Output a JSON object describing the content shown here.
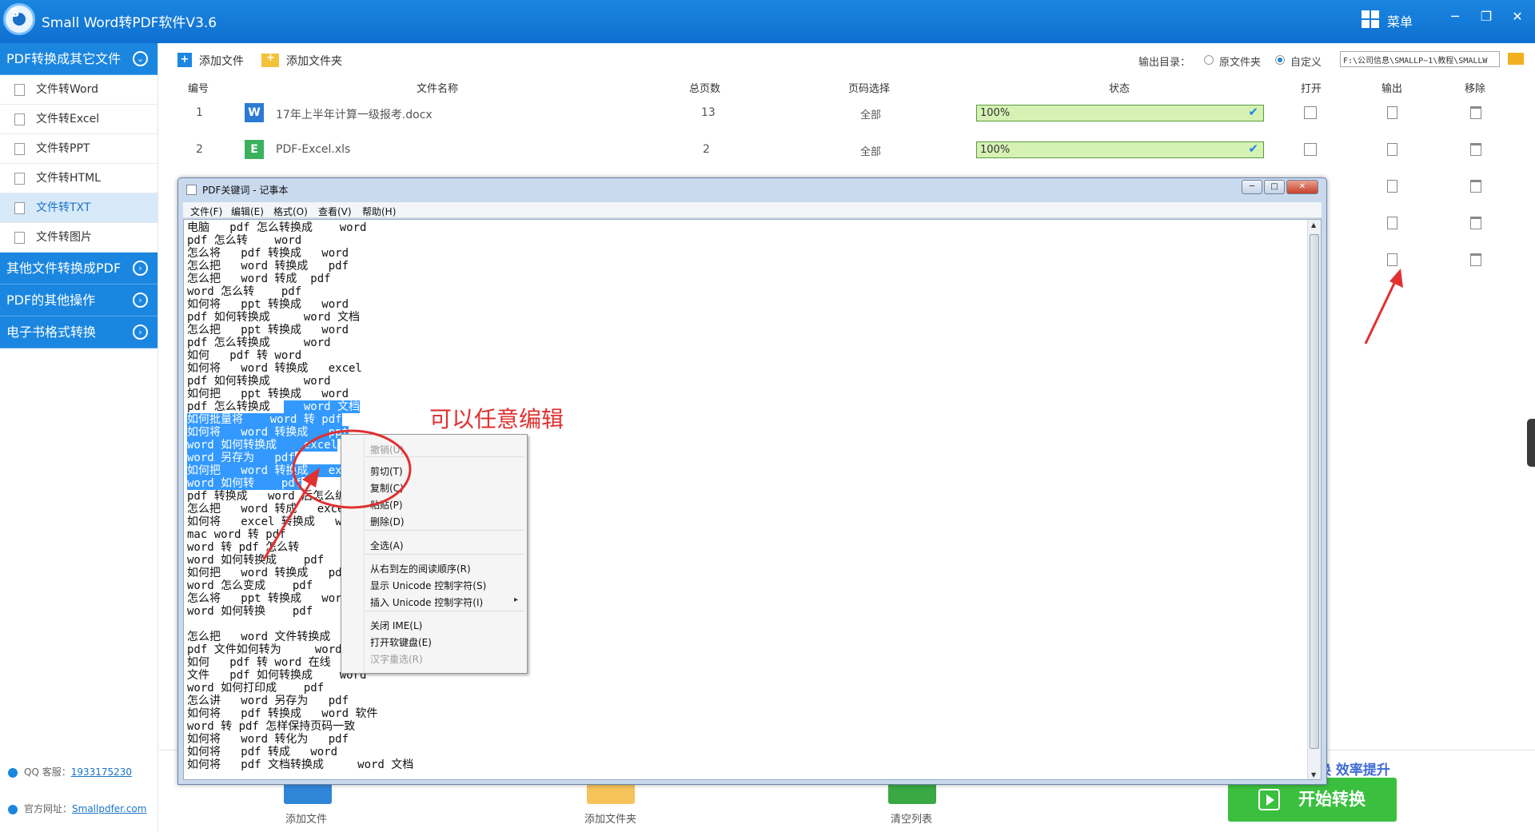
{
  "app": {
    "title": "Small  Word转PDF软件V3.6",
    "menu_label": "菜单",
    "window_minimize": "─",
    "window_restore": "❐",
    "window_close": "✕"
  },
  "sidebar": {
    "sections": [
      {
        "label": "PDF转换成其它文件",
        "expanded": true
      },
      {
        "label": "其他文件转换成PDF"
      },
      {
        "label": "PDF的其他操作"
      },
      {
        "label": "电子书格式转换"
      }
    ],
    "items": [
      {
        "label": "文件转Word",
        "icon": "W"
      },
      {
        "label": "文件转Excel",
        "icon": "E"
      },
      {
        "label": "文件转PPT",
        "icon": "P"
      },
      {
        "label": "文件转HTML",
        "icon": "H"
      },
      {
        "label": "文件转TXT",
        "icon": "T",
        "active": true
      },
      {
        "label": "文件转图片",
        "icon": "I"
      }
    ],
    "qq_label": "QQ 客服：",
    "qq_number": "1933175230",
    "site_label": "官方网址：",
    "site_url": "Smallpdfer.com"
  },
  "toolbar": {
    "add_file": "添加文件",
    "add_folder": "添加文件夹",
    "output_dir_label": "输出目录：",
    "radio_original": "原文件夹",
    "radio_custom": "自定义",
    "output_path": "F:\\公司信息\\SMALLP~1\\教程\\SMALLW"
  },
  "table": {
    "headers": {
      "num": "编号",
      "name": "文件名称",
      "pages": "总页数",
      "range": "页码选择",
      "status": "状态",
      "open": "打开",
      "output": "输出",
      "remove": "移除"
    },
    "rows": [
      {
        "num": "1",
        "name": "17年上半年计算一级报考.docx",
        "pages": "13",
        "range": "全部",
        "progress": "100%",
        "type": "W",
        "color": "#2b7bd3"
      },
      {
        "num": "2",
        "name": "PDF-Excel.xls",
        "pages": "2",
        "range": "全部",
        "progress": "100%",
        "type": "E",
        "color": "#3bb15e"
      }
    ]
  },
  "bottom": {
    "add_file": "添加文件",
    "add_folder": "添加文件夹",
    "clear_list": "清空列表",
    "start": "开始转换",
    "slogan": "换  效率提升"
  },
  "notepad": {
    "title": "PDF关键词 - 记事本",
    "menus": [
      "文件(F)",
      "编辑(E)",
      "格式(O)",
      "查看(V)",
      "帮助(H)"
    ],
    "lines": [
      "电脑   pdf 怎么转换成    word",
      "pdf 怎么转    word",
      "怎么将   pdf 转换成   word",
      "怎么把   word 转换成   pdf",
      "怎么把   word 转成  pdf",
      "word 怎么转    pdf",
      "如何将   ppt 转换成   word",
      "pdf 如何转换成     word 文档",
      "怎么把   ppt 转换成   word",
      "pdf 怎么转换成     word",
      "如何   pdf 转 word",
      "如何将   word 转换成   excel",
      "pdf 如何转换成     word",
      "如何把   ppt 转换成   word",
      "pdf 怎么转换成     word 文档",
      "如何批量将    word 转 pdf",
      "如何将   word 转换成   ppt",
      "word 如何转换成    excel",
      "word 另存为   pdf",
      "如何把   word 转换成   excel",
      "word 如何转    pdf",
      "pdf 转换成   word 后怎么编辑",
      "怎么把   word 转成   excel",
      "如何将   excel 转换成   word",
      "mac word 转 pdf",
      "word 转 pdf 怎么转",
      "word 如何转换成    pdf",
      "如何把   word 转换成   pdf",
      "word 怎么变成    pdf",
      "怎么将   ppt 转换成   word",
      "word 如何转换    pdf",
      "",
      "怎么把   word 文件转换成   pdf",
      "pdf 文件如何转为     word",
      "如何   pdf 转 word 在线",
      "文件   pdf 如何转换成    word",
      "word 如何打印成    pdf",
      "怎么讲   word 另存为   pdf",
      "如何将   pdf 转换成   word 软件",
      "word 转 pdf 怎样保持页码一致",
      "如何将   word 转化为   pdf",
      "如何将   pdf 转成   word",
      "如何将   pdf 文档转换成     word 文档"
    ],
    "selected_partial": "   word 文档",
    "context_menu": {
      "undo": "撤销(U)",
      "cut": "剪切(T)",
      "copy": "复制(C)",
      "paste": "粘贴(P)",
      "delete": "删除(D)",
      "select_all": "全选(A)",
      "rtl": "从右到左的阅读顺序(R)",
      "show_unicode": "显示 Unicode 控制字符(S)",
      "insert_unicode": "插入 Unicode 控制字符(I)",
      "close_ime": "关闭 IME(L)",
      "soft_keyboard": "打开软键盘(E)",
      "reconvert": "汉字重选(R)"
    }
  },
  "annotation": {
    "text": "可以任意编辑"
  },
  "colors": {
    "accent": "#1a86e0",
    "success": "#3bbf3f",
    "annotation": "#e03131"
  }
}
